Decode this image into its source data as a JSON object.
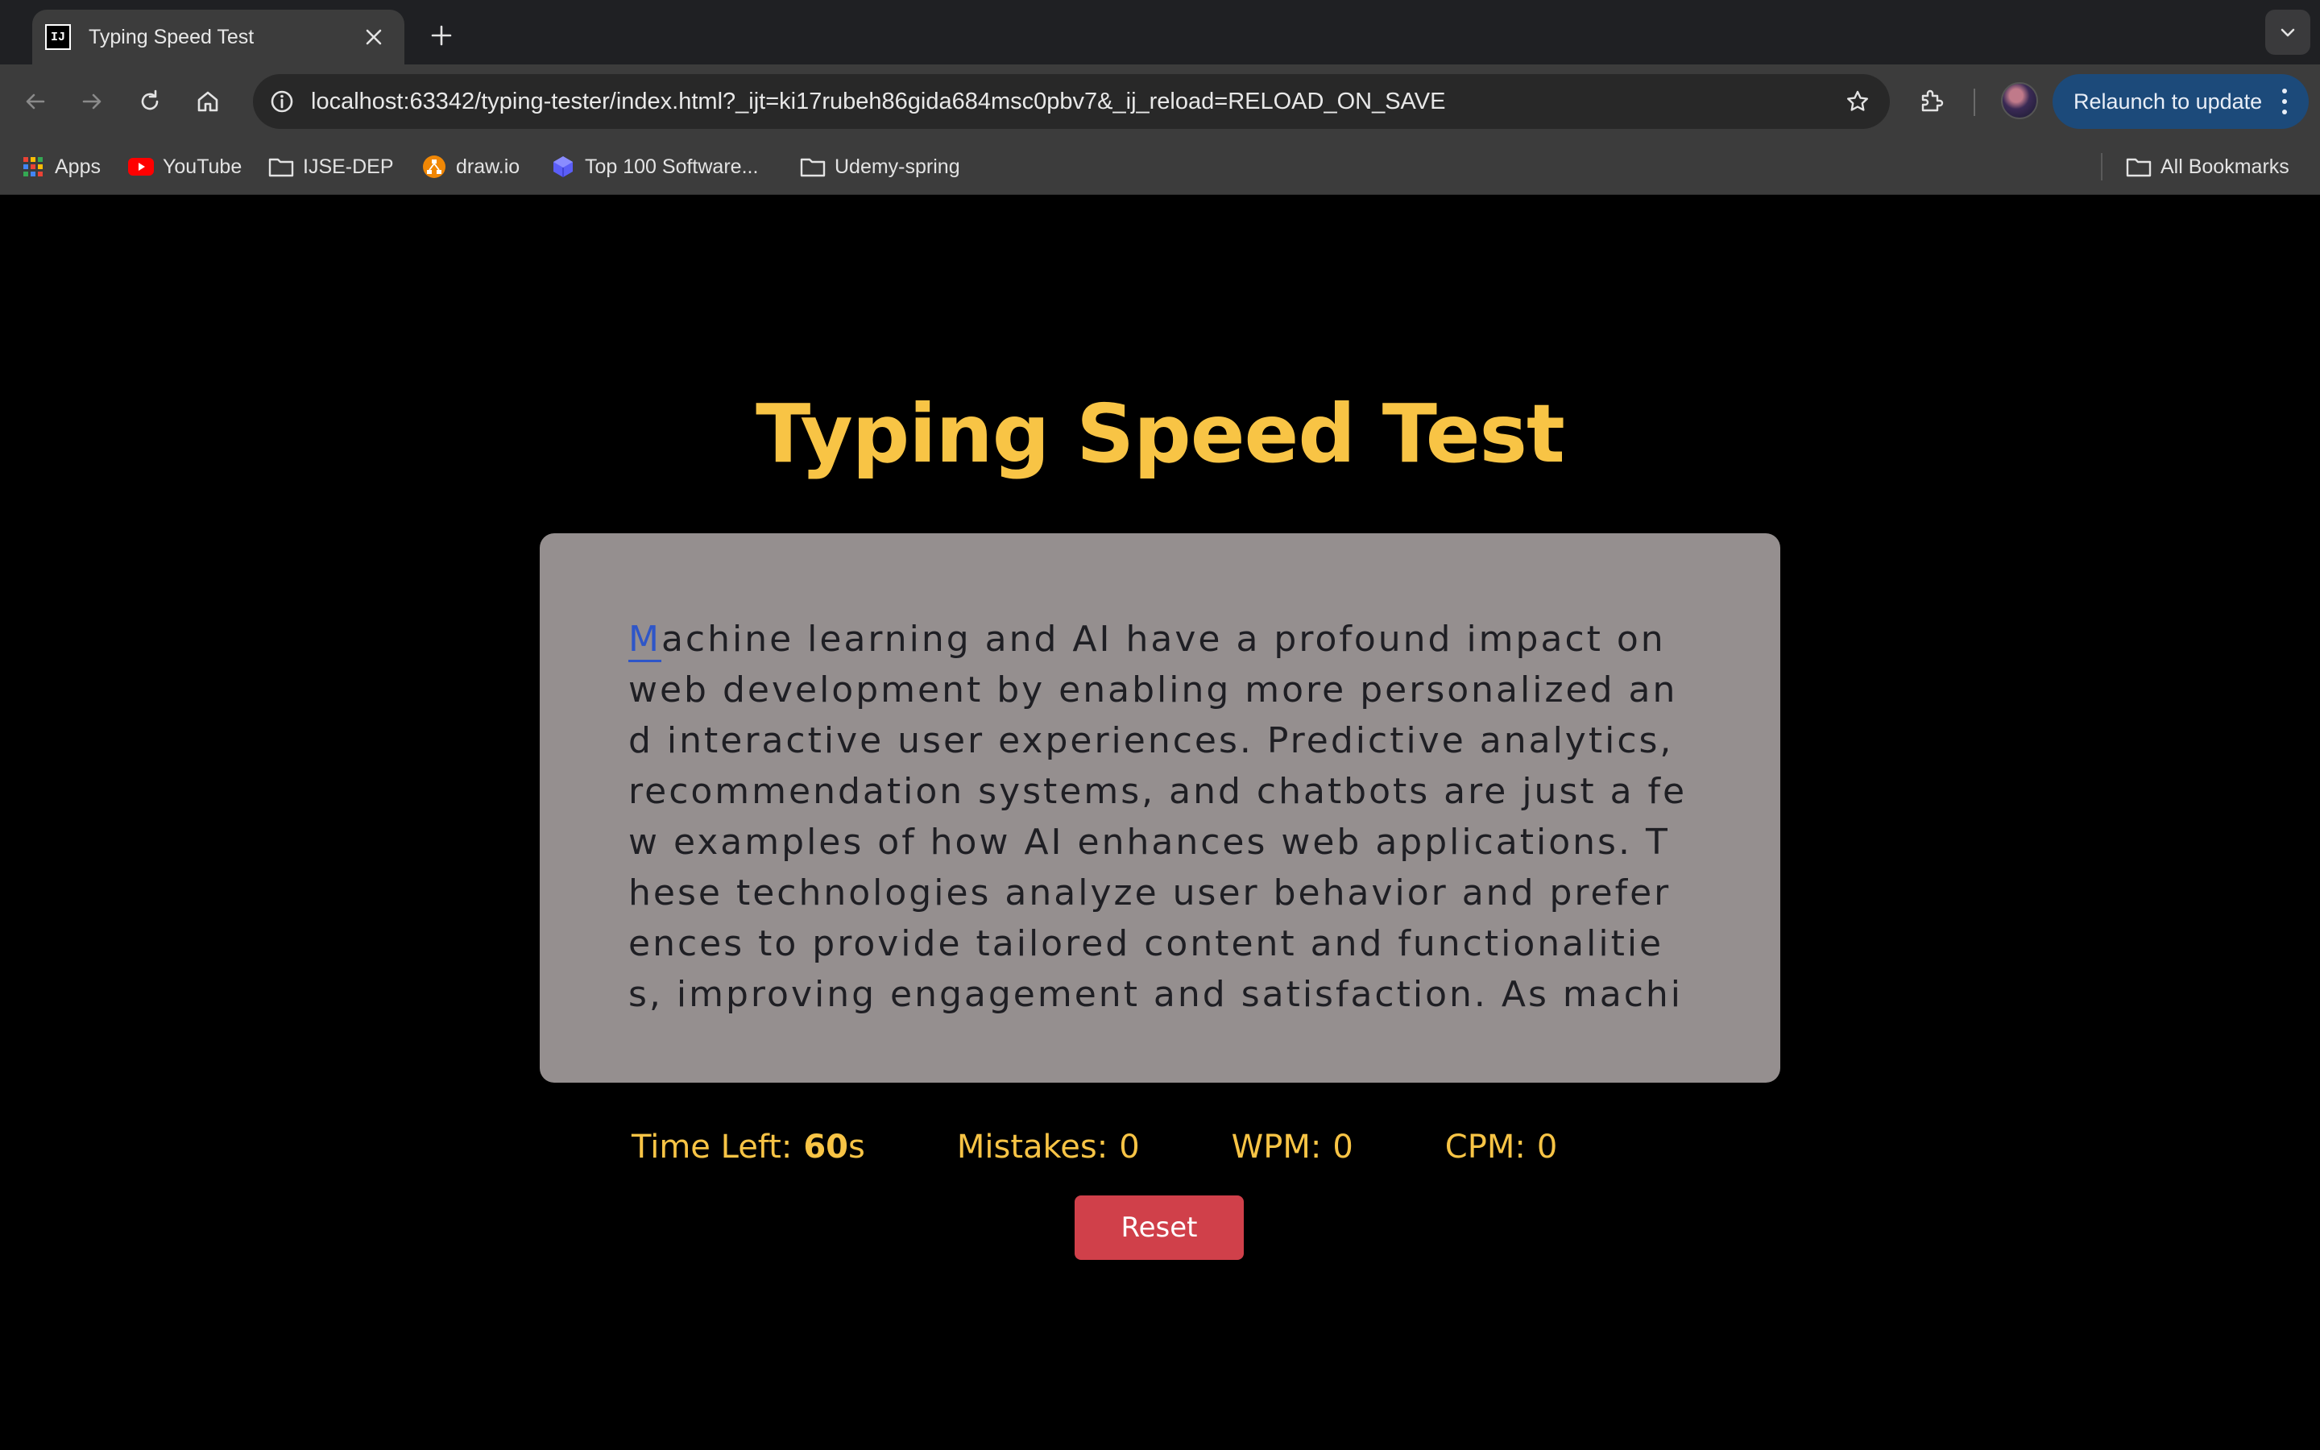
{
  "browser": {
    "tab": {
      "title": "Typing Speed Test",
      "favicon_text": "IJ"
    },
    "address": {
      "url": "localhost:63342/typing-tester/index.html?_ijt=ki17rubeh86gida684msc0pbv7&_ij_reload=RELOAD_ON_SAVE"
    },
    "relaunch_label": "Relaunch to update",
    "bookmarks": [
      {
        "label": "Apps",
        "icon": "apps-grid-icon"
      },
      {
        "label": "YouTube",
        "icon": "youtube-icon"
      },
      {
        "label": "IJSE-DEP",
        "icon": "folder-icon"
      },
      {
        "label": "draw.io",
        "icon": "drawio-icon"
      },
      {
        "label": "Top 100 Software...",
        "icon": "cube-icon"
      },
      {
        "label": "Udemy-spring",
        "icon": "folder-icon"
      }
    ],
    "all_bookmarks_label": "All Bookmarks"
  },
  "app": {
    "title": "Typing Speed Test",
    "paragraph": {
      "active_char": "M",
      "rest": "achine learning and AI have a profound impact on web development by enabling more personalized and interactive user experiences. Predictive analytics, recommendation systems, and chatbots are just a few examples of how AI enhances web applications. These technologies analyze user behavior and preferences to provide tailored content and functionalities, improving engagement and satisfaction. As machine learning models become more sophisticated"
    },
    "stats": {
      "time_left": {
        "label": "Time Left:",
        "value": "60",
        "unit": "s"
      },
      "mistakes": {
        "label": "Mistakes:",
        "value": "0"
      },
      "wpm": {
        "label": "WPM:",
        "value": "0"
      },
      "cpm": {
        "label": "CPM:",
        "value": "0"
      }
    },
    "reset_label": "Reset"
  },
  "colors": {
    "accent": "#f8c445",
    "box": "#958f8f",
    "active_char": "#2e56c8",
    "reset_button": "#d0404a"
  }
}
